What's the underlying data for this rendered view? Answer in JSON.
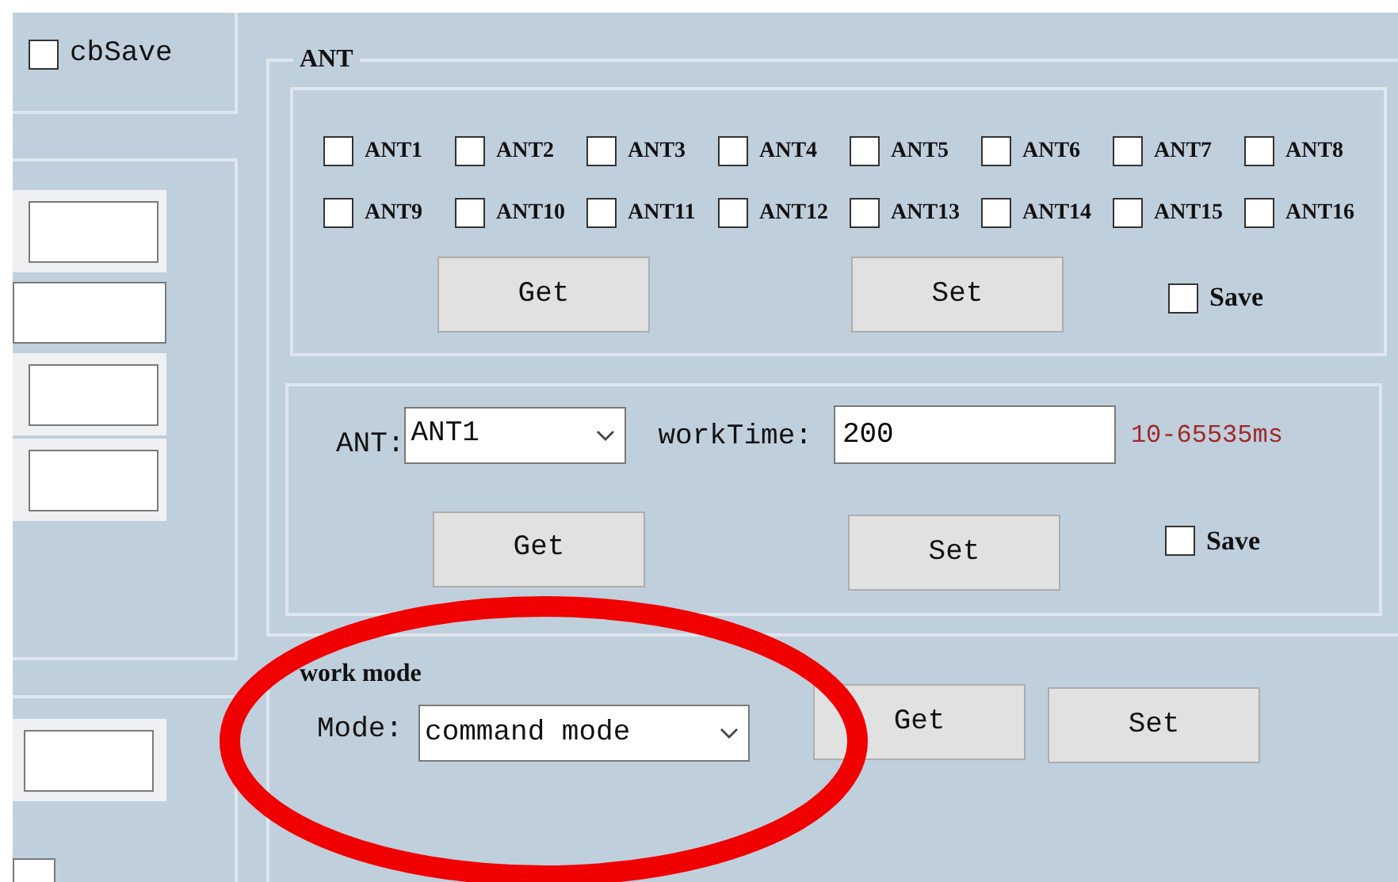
{
  "left_panel": {
    "save": {
      "label": "cbSave",
      "checked": false
    }
  },
  "ant_group": {
    "title": "ANT",
    "antennas": [
      {
        "label": "ANT1",
        "checked": false
      },
      {
        "label": "ANT2",
        "checked": false
      },
      {
        "label": "ANT3",
        "checked": false
      },
      {
        "label": "ANT4",
        "checked": false
      },
      {
        "label": "ANT5",
        "checked": false
      },
      {
        "label": "ANT6",
        "checked": false
      },
      {
        "label": "ANT7",
        "checked": false
      },
      {
        "label": "ANT8",
        "checked": false
      },
      {
        "label": "ANT9",
        "checked": false
      },
      {
        "label": "ANT10",
        "checked": false
      },
      {
        "label": "ANT11",
        "checked": false
      },
      {
        "label": "ANT12",
        "checked": false
      },
      {
        "label": "ANT13",
        "checked": false
      },
      {
        "label": "ANT14",
        "checked": false
      },
      {
        "label": "ANT15",
        "checked": false
      },
      {
        "label": "ANT16",
        "checked": false
      }
    ],
    "get_button": "Get",
    "set_button": "Set",
    "save": {
      "label": "Save",
      "checked": false
    }
  },
  "work_time": {
    "ant_label": "ANT:",
    "ant_value": "ANT1",
    "work_time_label": "workTime:",
    "work_time_value": "200",
    "range_hint": "10-65535ms",
    "get_button": "Get",
    "set_button": "Set",
    "save": {
      "label": "Save",
      "checked": false
    }
  },
  "work_mode": {
    "title": "work mode",
    "mode_label": "Mode:",
    "mode_value": "command mode",
    "get_button": "Get",
    "set_button": "Set"
  },
  "annotation": {
    "kind": "ellipse"
  }
}
